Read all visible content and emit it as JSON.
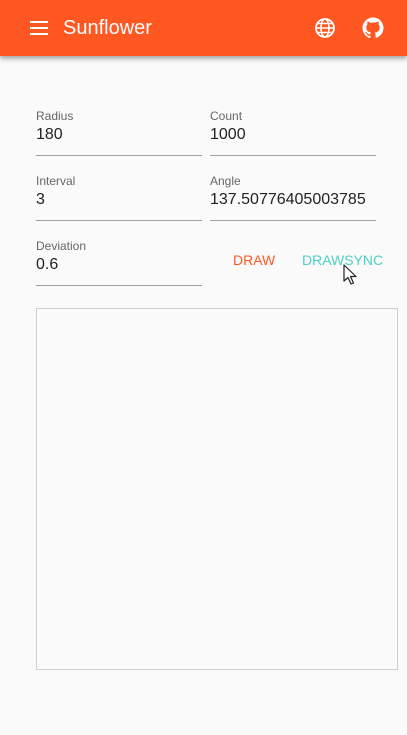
{
  "app": {
    "title": "Sunflower",
    "icons": [
      "menu-icon",
      "globe-icon",
      "github-icon"
    ]
  },
  "colors": {
    "toolbar": "#ff5722",
    "draw_button": "#ff5722",
    "drawsync_button": "#4dd0c4",
    "canvas_border": "#cfcfcf"
  },
  "form": {
    "radius": {
      "label": "Radius",
      "value": "180"
    },
    "count": {
      "label": "Count",
      "value": "1000"
    },
    "interval": {
      "label": "Interval",
      "value": "3"
    },
    "angle": {
      "label": "Angle",
      "value": "137.50776405003785"
    },
    "deviation": {
      "label": "Deviation",
      "value": "0.6"
    }
  },
  "buttons": {
    "draw": "DRAW",
    "drawsync": "DRAWSYNC"
  }
}
